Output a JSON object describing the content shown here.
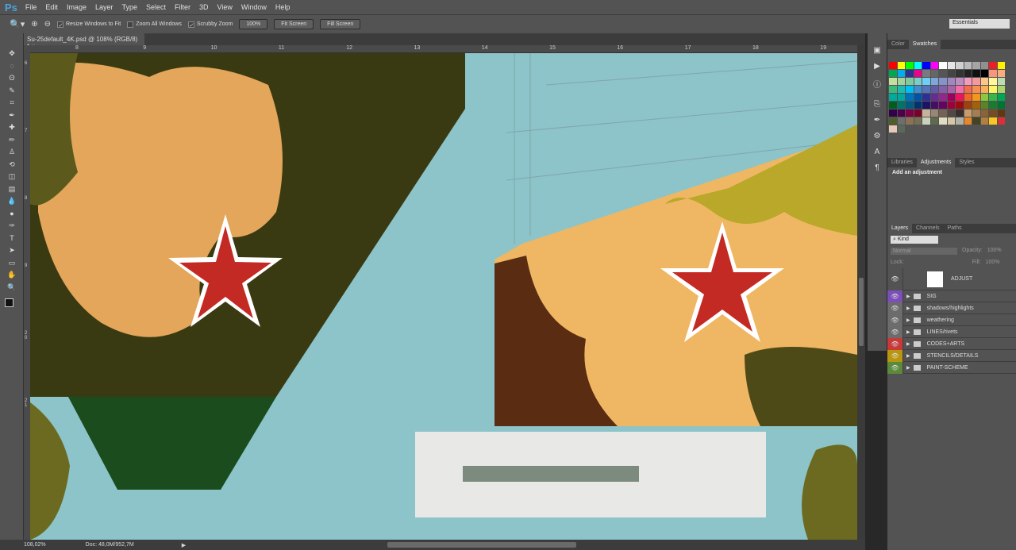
{
  "app": {
    "logo": "Ps"
  },
  "menu": [
    "File",
    "Edit",
    "Image",
    "Layer",
    "Type",
    "Select",
    "Filter",
    "3D",
    "View",
    "Window",
    "Help"
  ],
  "options": {
    "resize_windows": "Resize Windows to Fit",
    "zoom_all": "Zoom All Windows",
    "scrubby": "Scrubby Zoom",
    "btn_100": "100%",
    "fit_screen": "Fit Screen",
    "fill_screen": "Fill Screen",
    "workspace": "Essentials"
  },
  "document": {
    "tab": "Su-25default_4K.psd @ 108% (RGB/8) *",
    "close": "×"
  },
  "ruler": [
    "8",
    "9",
    "10",
    "11",
    "12",
    "13",
    "14",
    "15",
    "16",
    "17",
    "18",
    "19"
  ],
  "ruler_left": [
    "6",
    "7",
    "8",
    "9",
    "2 0",
    "2 1"
  ],
  "status": {
    "zoom": "108,02%",
    "doc": "Doc: 48,0M/952,7M"
  },
  "panels": {
    "color_tabs": [
      "Color",
      "Swatches"
    ],
    "swatches": [
      "#ff0000",
      "#ffff00",
      "#00ff00",
      "#00ffff",
      "#0000ff",
      "#ff00ff",
      "#ffffff",
      "#e6e6e6",
      "#d0d0d0",
      "#bbbbbb",
      "#a5a5a5",
      "#909090",
      "#ee1c24",
      "#fff200",
      "#00a651",
      "#00aeef",
      "#2e3192",
      "#ec008c",
      "#7a7a7a",
      "#666666",
      "#555555",
      "#444444",
      "#333333",
      "#222222",
      "#111111",
      "#000000",
      "#f7977a",
      "#fbad82",
      "#c4df9b",
      "#a3d39c",
      "#82ca9d",
      "#7bcdc8",
      "#6ecff6",
      "#7ea7d8",
      "#8493ca",
      "#a187be",
      "#bc8dbf",
      "#f49ac1",
      "#f5989d",
      "#fdc689",
      "#fff799",
      "#bddbb0",
      "#3cb878",
      "#1cbbb4",
      "#00bff3",
      "#448ccb",
      "#5574b9",
      "#605ca8",
      "#855fa8",
      "#a864a8",
      "#f06eaa",
      "#f26c4f",
      "#f68e55",
      "#fbaf5c",
      "#fff467",
      "#acd372",
      "#00a99d",
      "#00a99d",
      "#0072bc",
      "#0054a6",
      "#2e3192",
      "#662d91",
      "#92278f",
      "#9e005d",
      "#ed145b",
      "#f26522",
      "#f7941d",
      "#8dc63f",
      "#39b54a",
      "#00a651",
      "#005e20",
      "#00746b",
      "#005b7f",
      "#003471",
      "#1b1464",
      "#440e62",
      "#630460",
      "#9e0039",
      "#9e0b0f",
      "#a0410d",
      "#a36209",
      "#598527",
      "#197b30",
      "#007236",
      "#32004b",
      "#4b0049",
      "#7b0046",
      "#7a0026",
      "#c7b299",
      "#998675",
      "#736357",
      "#534741",
      "#362f2d",
      "#c69c6d",
      "#a67c52",
      "#8c6239",
      "#754c24",
      "#603913",
      "#4e5d2a",
      "#6e6e6e",
      "#8a7355",
      "#757055",
      "#c9d2bb",
      "#5d6a4d",
      "#e1dcc4",
      "#d5c6a5",
      "#b0b2a6",
      "#e8862a",
      "#444422",
      "#b08040",
      "#f8c820",
      "#d8303a",
      "#e8c8b8",
      "#5a6a5a"
    ],
    "adj_tabs": [
      "Libraries",
      "Adjustments",
      "Styles"
    ],
    "adj_title": "Add an adjustment",
    "layer_tabs": [
      "Layers",
      "Channels",
      "Paths"
    ],
    "kind": "Kind",
    "blend": "Normal",
    "opacity_label": "Opacity:",
    "opacity": "100%",
    "lock_label": "Lock:",
    "fill_label": "Fill:",
    "fill": "100%",
    "layers": [
      {
        "name": "ADJUST",
        "color": "#535353"
      },
      {
        "name": "SIG",
        "color": "#7c4fb8"
      },
      {
        "name": "shadows/highlights",
        "color": "#6c6c6c"
      },
      {
        "name": "weathering",
        "color": "#6c6c6c"
      },
      {
        "name": "LINES/rivets",
        "color": "#6c6c6c"
      },
      {
        "name": "CODES+ARTS",
        "color": "#c83a3a"
      },
      {
        "name": "STENCILS/DETAILS",
        "color": "#b8960e"
      },
      {
        "name": "PAINT-SCHEME",
        "color": "#5a8a3a"
      }
    ]
  }
}
